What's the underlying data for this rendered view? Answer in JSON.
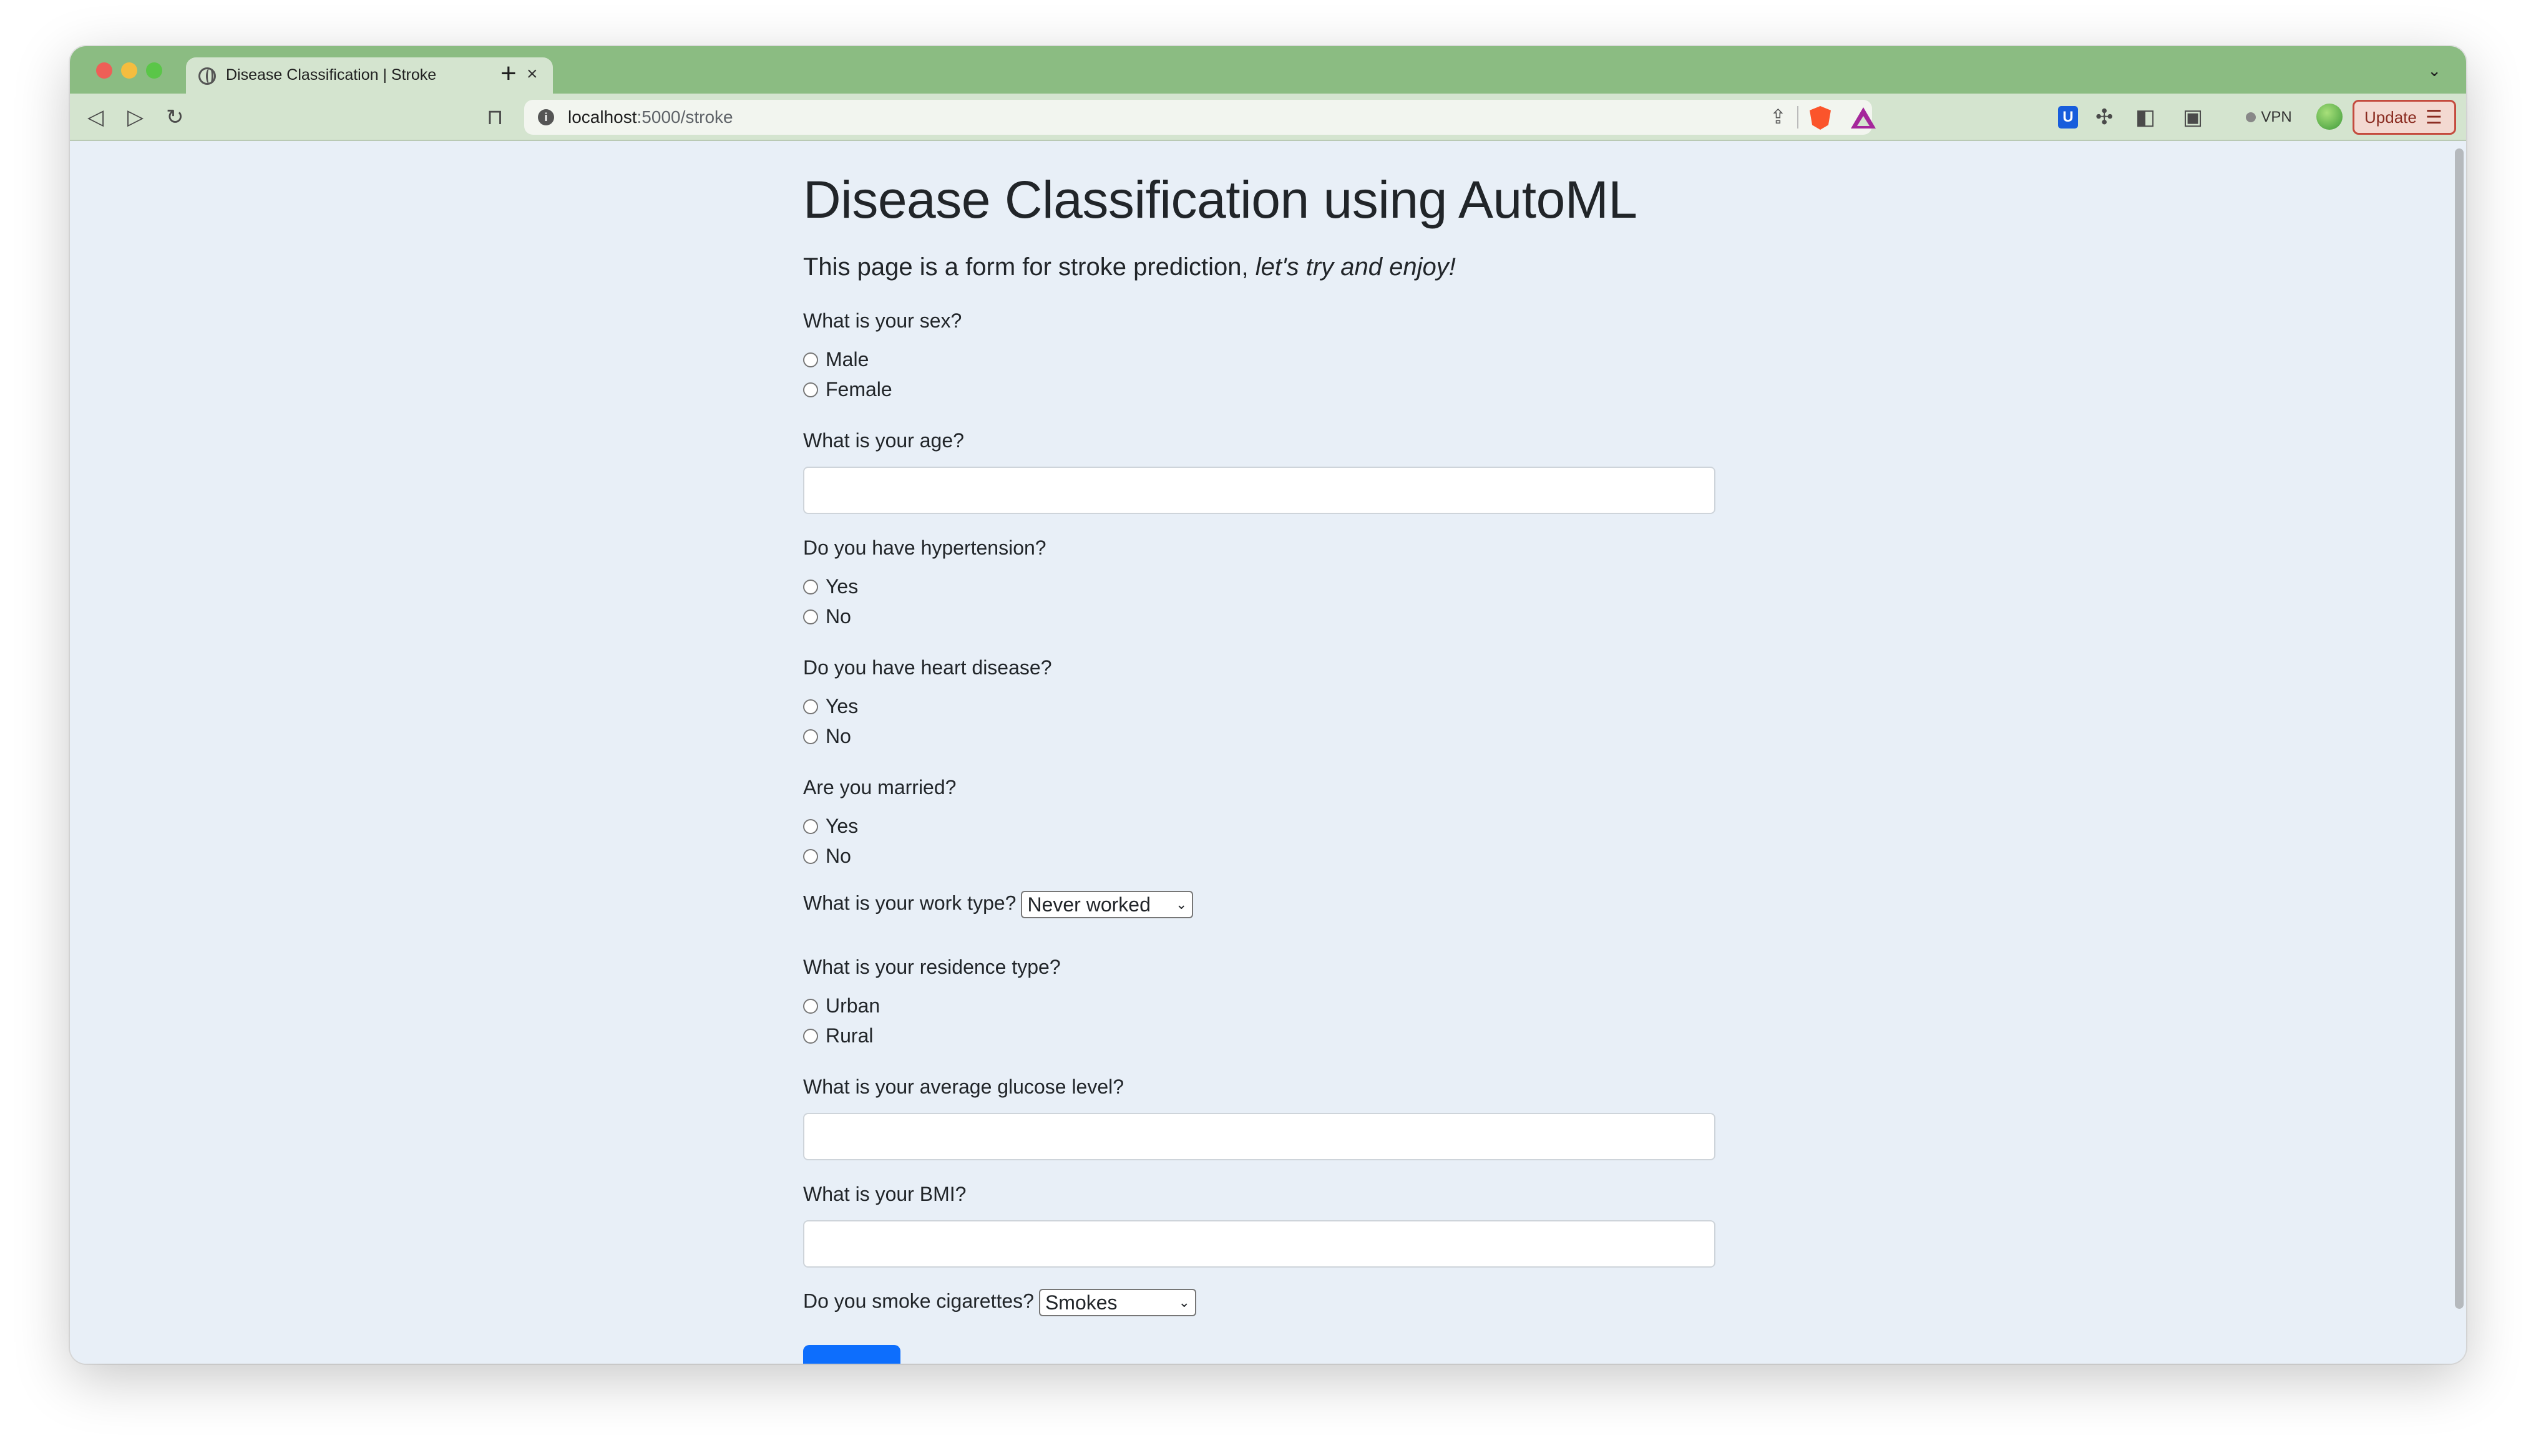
{
  "browser": {
    "tab": {
      "title": "Disease Classification | Stroke",
      "close": "×"
    },
    "new_tab": "+",
    "tablist_chevron": "⌄",
    "url": {
      "host": "localhost",
      "path": ":5000/stroke"
    },
    "vpn_label": "VPN",
    "update_label": "Update",
    "icons": {
      "back": "◁",
      "forward": "▷",
      "reload": "↻",
      "bookmark": "⊓",
      "share": "⇪",
      "extensions": "✣",
      "sidebar": "◧",
      "wallet": "▣",
      "menu": "☰"
    },
    "colors": {
      "tabstrip": "#8bbc82",
      "toolbar": "#d4e4cf",
      "page": "#e8eff7"
    }
  },
  "page": {
    "title": "Disease Classification using AutoML",
    "lead_plain": "This page is a form for stroke prediction, ",
    "lead_italic": "let's try and enjoy!",
    "questions": {
      "sex": {
        "label": "What is your sex?",
        "options": [
          "Male",
          "Female"
        ]
      },
      "age": {
        "label": "What is your age?"
      },
      "hypertension": {
        "label": "Do you have hypertension?",
        "options": [
          "Yes",
          "No"
        ]
      },
      "heart_disease": {
        "label": "Do you have heart disease?",
        "options": [
          "Yes",
          "No"
        ]
      },
      "married": {
        "label": "Are you married?",
        "options": [
          "Yes",
          "No"
        ]
      },
      "work_type": {
        "label": "What is your work type?",
        "selected": "Never worked"
      },
      "residence": {
        "label": "What is your residence type?",
        "options": [
          "Urban",
          "Rural"
        ]
      },
      "glucose": {
        "label": "What is your average glucose level?"
      },
      "bmi": {
        "label": "What is your BMI?"
      },
      "smoking": {
        "label": "Do you smoke cigarettes?",
        "selected": "Smokes"
      }
    },
    "submit_color": "#0d6efd"
  }
}
